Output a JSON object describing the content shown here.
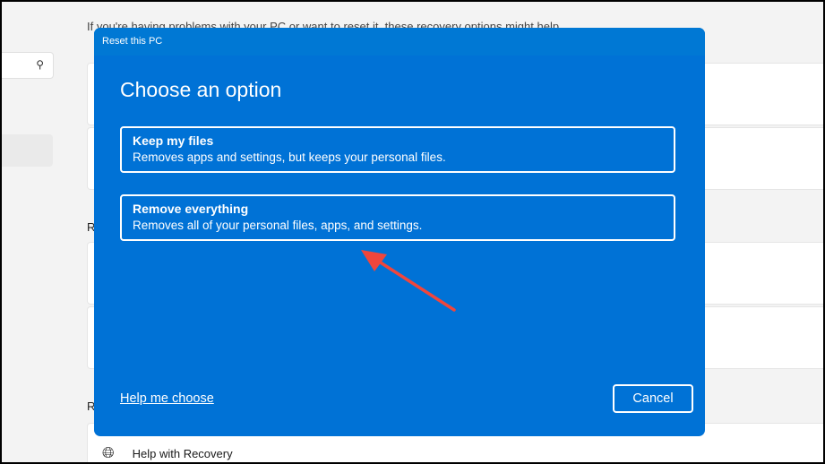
{
  "background": {
    "subtitle": "If you're having problems with your PC or want to reset it, these recovery options might help.",
    "section_letter_1": "R",
    "section_letter_2": "R",
    "help_item": "Help with Recovery"
  },
  "dialog": {
    "title": "Reset this PC",
    "heading": "Choose an option",
    "options": [
      {
        "title": "Keep my files",
        "desc": "Removes apps and settings, but keeps your personal files."
      },
      {
        "title": "Remove everything",
        "desc": "Removes all of your personal files, apps, and settings."
      }
    ],
    "help_link": "Help me choose",
    "cancel": "Cancel"
  },
  "colors": {
    "dialog_bg": "#0072d6",
    "annotation_arrow": "#f0463c"
  }
}
